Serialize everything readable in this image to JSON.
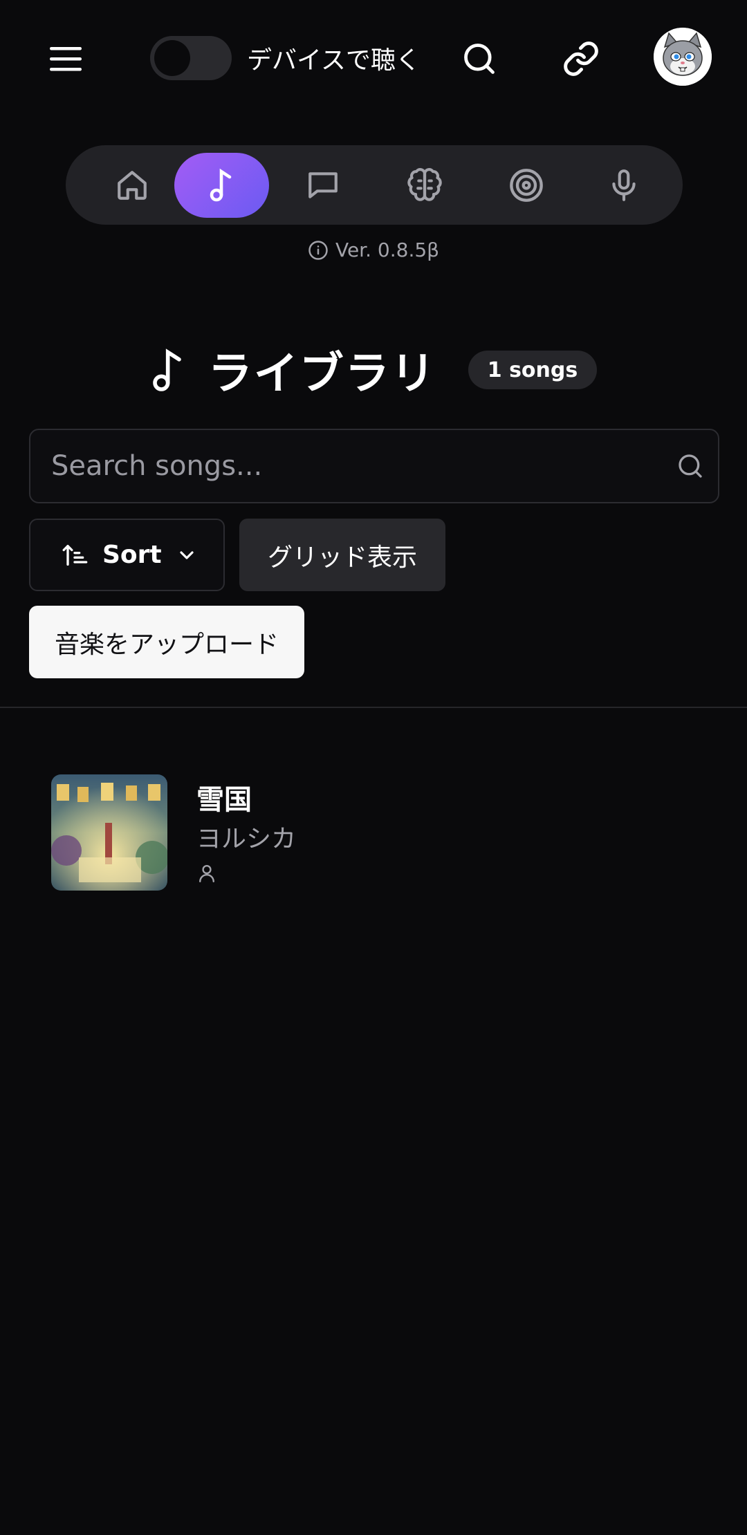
{
  "header": {
    "toggle_label": "デバイスで聴く",
    "toggle_on": false
  },
  "nav": {
    "items": [
      {
        "icon": "home-icon",
        "active": false
      },
      {
        "icon": "music-note-icon",
        "active": true
      },
      {
        "icon": "chat-icon",
        "active": false
      },
      {
        "icon": "brain-icon",
        "active": false
      },
      {
        "icon": "target-icon",
        "active": false
      },
      {
        "icon": "microphone-icon",
        "active": false
      }
    ],
    "accent": "#8b5cf6"
  },
  "version": "Ver. 0.8.5β",
  "library": {
    "title": "ライブラリ",
    "count_badge": "1 songs"
  },
  "search": {
    "placeholder": "Search songs...",
    "value": ""
  },
  "controls": {
    "sort_label": "Sort",
    "grid_label": "グリッド表示",
    "upload_label": "音楽をアップロード"
  },
  "songs": [
    {
      "title": "雪国",
      "artist": "ヨルシカ"
    }
  ]
}
